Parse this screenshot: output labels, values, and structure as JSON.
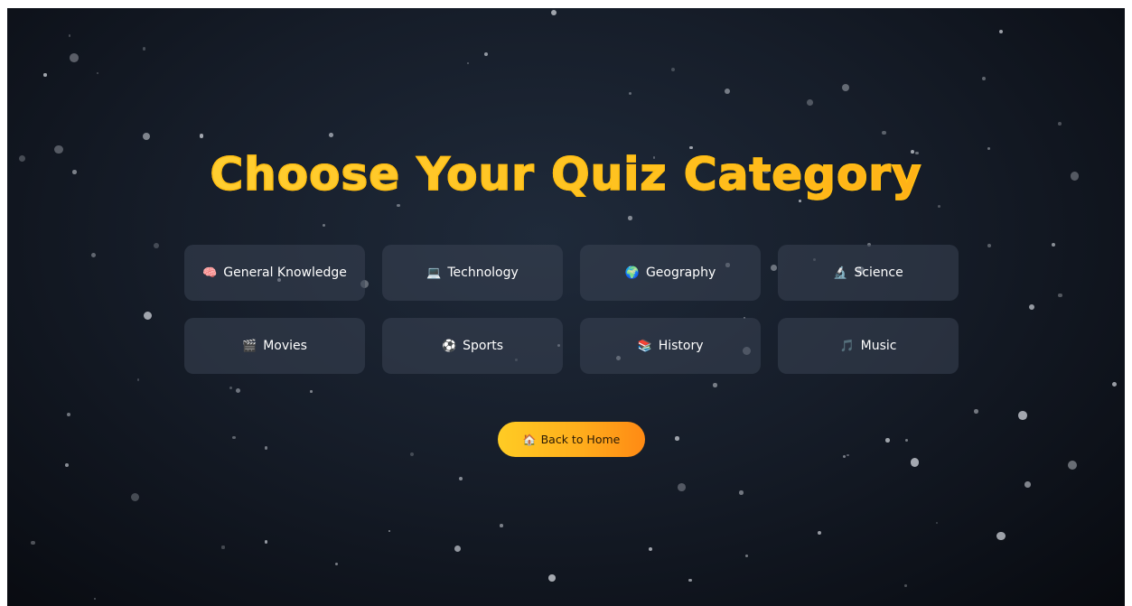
{
  "page": {
    "title": "Choose Your Quiz Category"
  },
  "categories": [
    {
      "label": "General Knowledge",
      "icon": "🧠",
      "icon_name": "brain-icon"
    },
    {
      "label": "Technology",
      "icon": "💻",
      "icon_name": "laptop-icon"
    },
    {
      "label": "Geography",
      "icon": "🌍",
      "icon_name": "globe-icon"
    },
    {
      "label": "Science",
      "icon": "🔬",
      "icon_name": "microscope-icon"
    },
    {
      "label": "Movies",
      "icon": "🎬",
      "icon_name": "clapperboard-icon"
    },
    {
      "label": "Sports",
      "icon": "⚽",
      "icon_name": "soccer-ball-icon"
    },
    {
      "label": "History",
      "icon": "📚",
      "icon_name": "books-icon"
    },
    {
      "label": "Music",
      "icon": "🎵",
      "icon_name": "music-note-icon"
    }
  ],
  "back_button": {
    "label": "Back to Home",
    "icon": "🏠",
    "icon_name": "house-icon"
  },
  "colors": {
    "title_accent": "#ffc21a",
    "button_gradient_start": "#ffcc24",
    "button_gradient_end": "#ff8a14",
    "card_background": "#3a4454",
    "background_dark": "#161d29"
  }
}
